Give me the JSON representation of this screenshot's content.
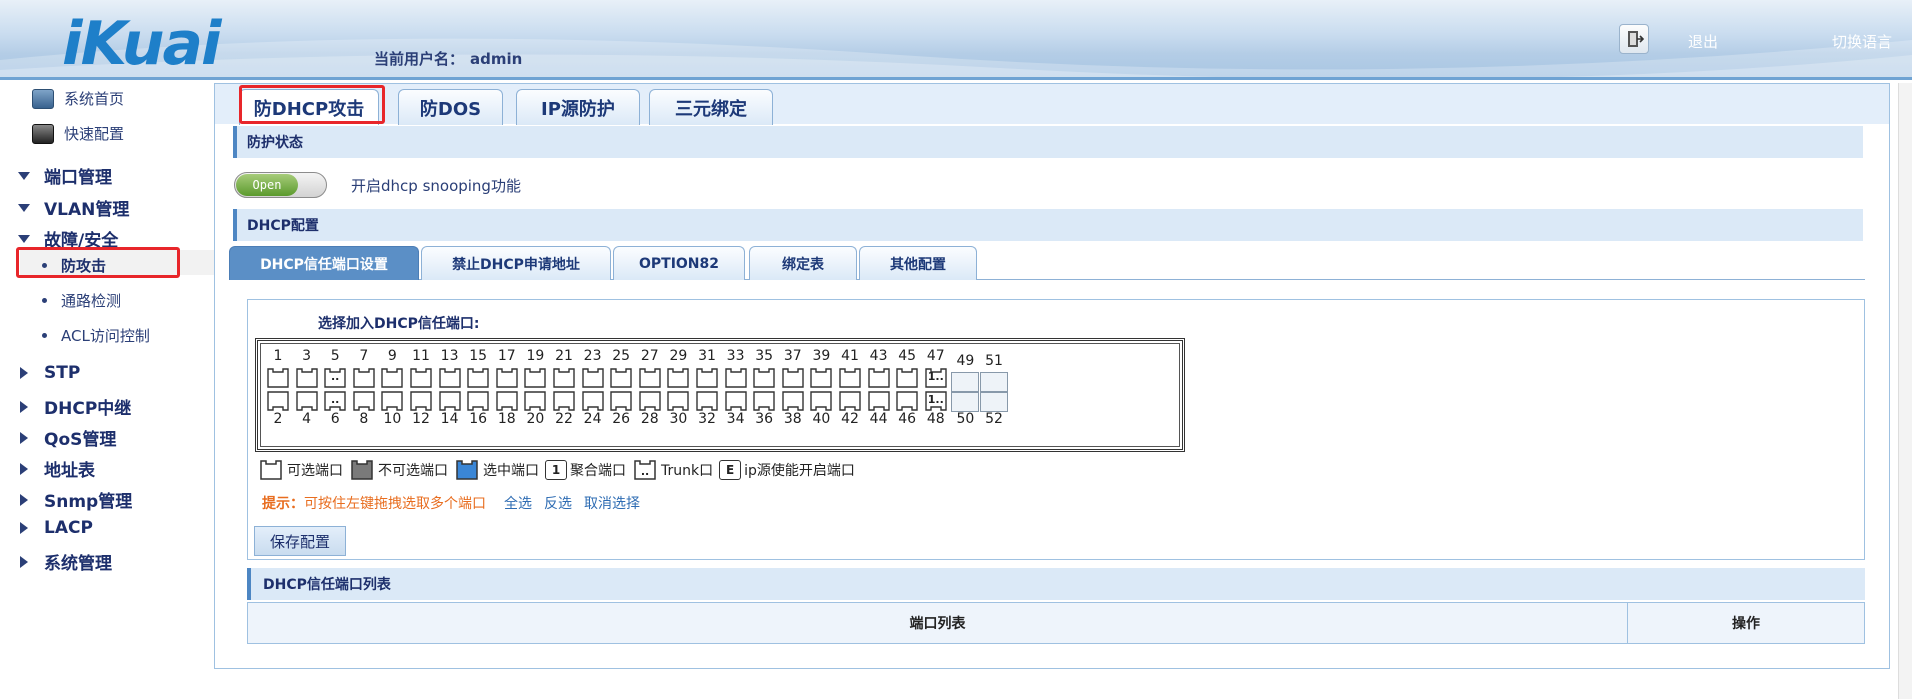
{
  "header": {
    "logo": "iKuai",
    "user_label": "当前用户名：",
    "username": "admin",
    "exit_label": "退出",
    "lang_label": "切换语言"
  },
  "sidebar": {
    "home": "系统首页",
    "quick": "快速配置",
    "port_mgmt": "端口管理",
    "vlan_mgmt": "VLAN管理",
    "fault_security": "故障/安全",
    "anti_attack": "防攻击",
    "path_detect": "通路检测",
    "acl": "ACL访问控制",
    "stp": "STP",
    "dhcp_relay": "DHCP中继",
    "qos": "QoS管理",
    "addr_table": "地址表",
    "snmp": "Snmp管理",
    "lacp": "LACP",
    "sys_mgmt": "系统管理"
  },
  "top_tabs": {
    "t1": "防DHCP攻击",
    "t2": "防DOS",
    "t3": "IP源防护",
    "t4": "三元绑定"
  },
  "protect": {
    "section_title": "防护状态",
    "toggle_text": "Open",
    "toggle_label": "开启dhcp snooping功能"
  },
  "dhcp_config": {
    "section_title": "DHCP配置",
    "tabs": {
      "s1": "DHCP信任端口设置",
      "s2": "禁止DHCP申请地址",
      "s3": "OPTION82",
      "s4": "绑定表",
      "s5": "其他配置"
    },
    "panel_title": "选择加入DHCP信任端口:",
    "top_ports": [
      "1",
      "3",
      "5",
      "7",
      "9",
      "11",
      "13",
      "15",
      "17",
      "19",
      "21",
      "23",
      "25",
      "27",
      "29",
      "31",
      "33",
      "35",
      "37",
      "39",
      "41",
      "43",
      "45",
      "47",
      "49",
      "51"
    ],
    "bottom_ports": [
      "2",
      "4",
      "6",
      "8",
      "10",
      "12",
      "14",
      "16",
      "18",
      "20",
      "22",
      "24",
      "26",
      "28",
      "30",
      "32",
      "34",
      "36",
      "38",
      "40",
      "42",
      "44",
      "46",
      "48",
      "50",
      "52"
    ],
    "port_marks": {
      "trunk": "..",
      "agg": "1..",
      "agg_num": "1",
      "ipsrc": "E"
    },
    "legend": {
      "selectable": "可选端口",
      "unselectable": "不可选端口",
      "selected": "选中端口",
      "aggregate": "聚合端口",
      "trunk": "Trunk口",
      "ipsrc": "ip源使能开启端口"
    },
    "hint_label": "提示：",
    "hint_text": "可按住左键拖拽选取多个端口",
    "select_all": "全选",
    "invert": "反选",
    "cancel": "取消选择",
    "save": "保存配置"
  },
  "trust_list": {
    "title": "DHCP信任端口列表",
    "col_ports": "端口列表",
    "col_ops": "操作"
  },
  "colors": {
    "accent": "#4d86c3",
    "highlight": "#e8262a",
    "hint": "#e86d1f",
    "toggle_on": "#5b9a2d"
  }
}
